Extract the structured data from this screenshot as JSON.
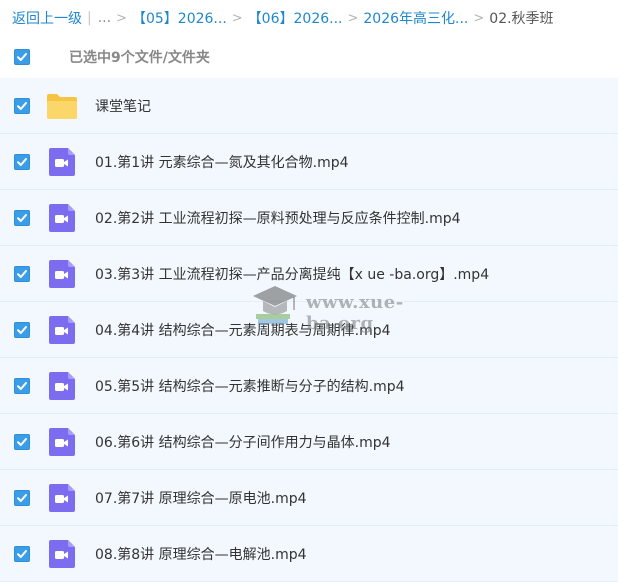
{
  "breadcrumb": {
    "back_label": "返回上一级",
    "ellipsis": "...",
    "items": [
      {
        "label": "【05】2026..."
      },
      {
        "label": "【06】2026..."
      },
      {
        "label": "2026年高三化..."
      }
    ],
    "current": "02.秋季班"
  },
  "selection": {
    "all_checked": true,
    "summary": "已选中9个文件/文件夹"
  },
  "files": [
    {
      "name": "课堂笔记",
      "type": "folder",
      "icon": "folder-icon",
      "checked": true
    },
    {
      "name": "01.第1讲 元素综合—氮及其化合物.mp4",
      "type": "video",
      "icon": "video-file-icon",
      "checked": true
    },
    {
      "name": "02.第2讲 工业流程初探—原料预处理与反应条件控制.mp4",
      "type": "video",
      "icon": "video-file-icon",
      "checked": true
    },
    {
      "name": "03.第3讲 工业流程初探—产品分离提纯【x ue -ba.org】.mp4",
      "type": "video",
      "icon": "video-file-icon",
      "checked": true
    },
    {
      "name": "04.第4讲 结构综合—元素周期表与周期律.mp4",
      "type": "video",
      "icon": "video-file-icon",
      "checked": true
    },
    {
      "name": "05.第5讲 结构综合—元素推断与分子的结构.mp4",
      "type": "video",
      "icon": "video-file-icon",
      "checked": true
    },
    {
      "name": "06.第6讲 结构综合—分子间作用力与晶体.mp4",
      "type": "video",
      "icon": "video-file-icon",
      "checked": true
    },
    {
      "name": "07.第7讲 原理综合—原电池.mp4",
      "type": "video",
      "icon": "video-file-icon",
      "checked": true
    },
    {
      "name": "08.第8讲 原理综合—电解池.mp4",
      "type": "video",
      "icon": "video-file-icon",
      "checked": true
    }
  ],
  "watermark": {
    "text": "www.xue-ba.org"
  },
  "colors": {
    "link": "#1e88cf",
    "checkbox": "#3b9de8",
    "row_bg": "#f2f8fd",
    "folder": "#f9d062",
    "video": "#7b6cf0"
  }
}
